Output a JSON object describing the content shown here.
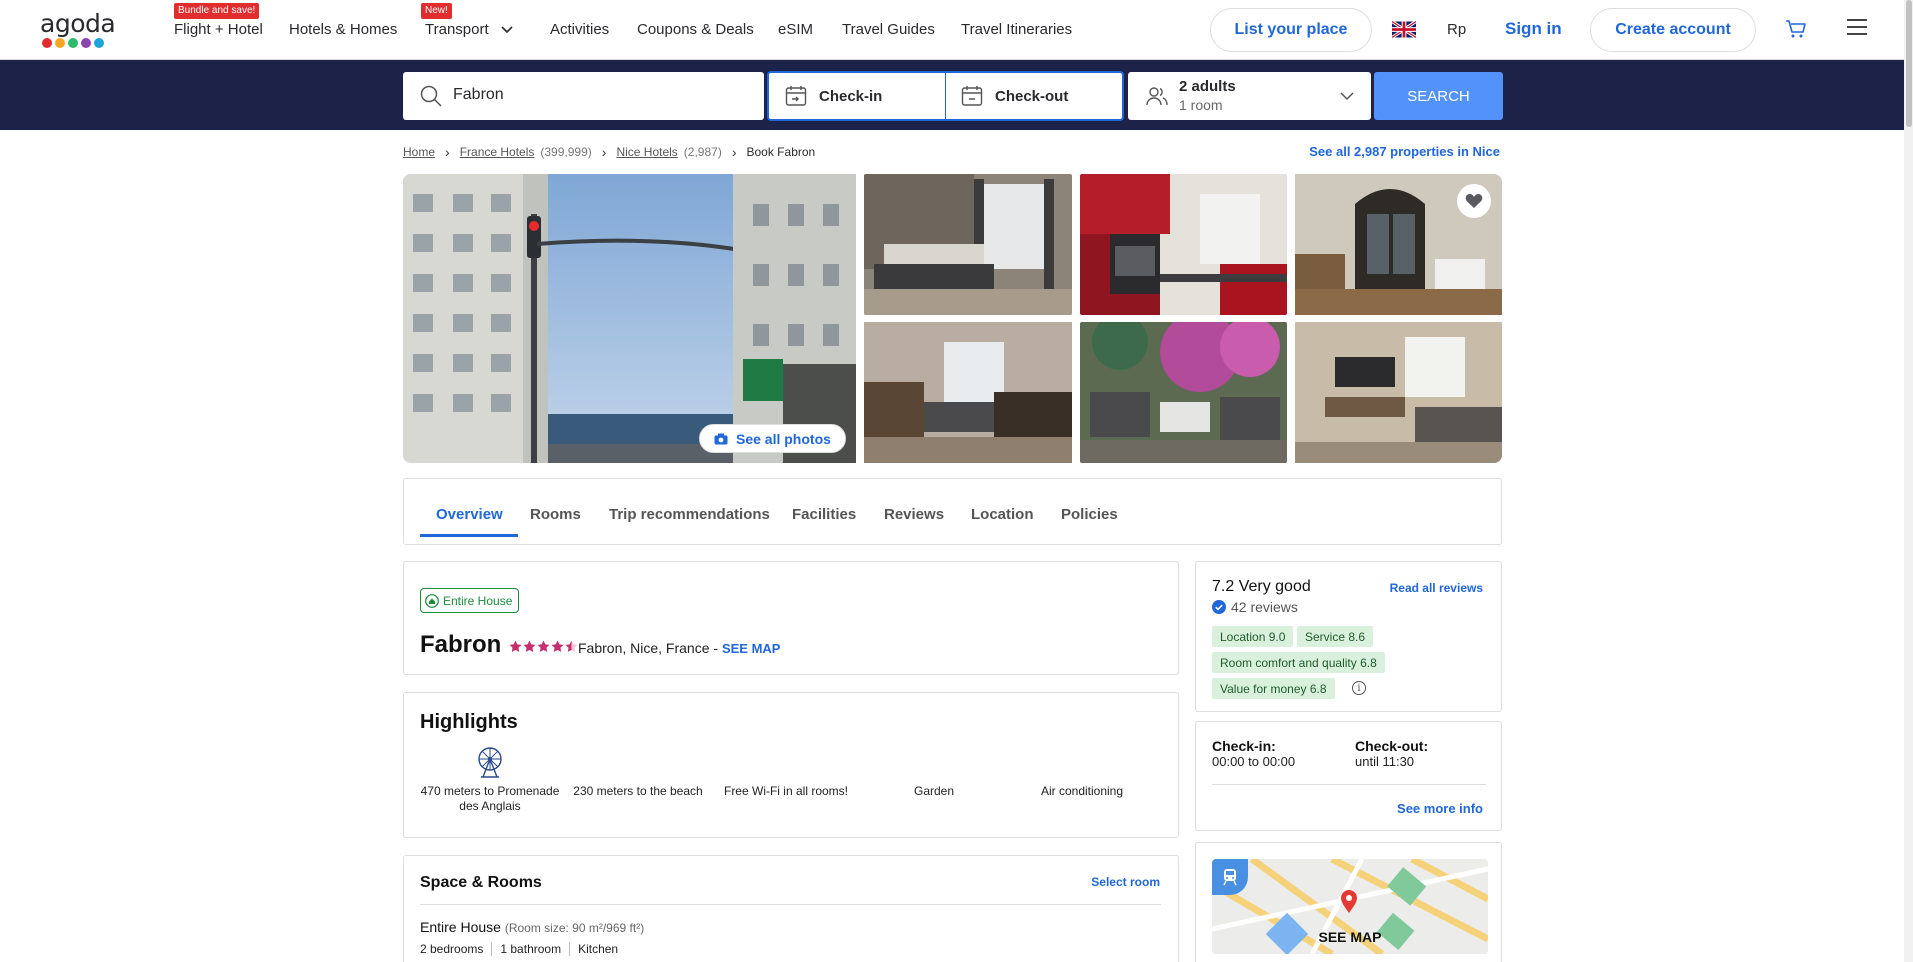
{
  "brand": {
    "name": "agoda",
    "dot_colors": [
      "#e12d2d",
      "#f5a623",
      "#2dbc6b",
      "#8e44ad",
      "#1fa3dd"
    ]
  },
  "topnav": {
    "items": [
      {
        "label": "Flight + Hotel",
        "badge": "Bundle and save!"
      },
      {
        "label": "Hotels & Homes"
      },
      {
        "label": "Transport",
        "badge": "New!"
      },
      {
        "label": "Activities"
      },
      {
        "label": "Coupons & Deals"
      },
      {
        "label": "eSIM"
      },
      {
        "label": "Travel Guides"
      },
      {
        "label": "Travel Itineraries"
      }
    ],
    "list_place": "List your place",
    "currency": "Rp",
    "sign_in": "Sign in",
    "create_account": "Create account"
  },
  "search": {
    "destination": "Fabron",
    "check_in": "Check-in",
    "check_out": "Check-out",
    "guests": "2 adults",
    "rooms": "1 room",
    "button": "SEARCH"
  },
  "breadcrumb": {
    "home": "Home",
    "country": "France Hotels",
    "country_count": "(399,999)",
    "city": "Nice Hotels",
    "city_count": "(2,987)",
    "current": "Book Fabron",
    "see_all": "See all 2,987 properties in Nice"
  },
  "gallery": {
    "see_all_photos": "See all photos"
  },
  "tabs": [
    "Overview",
    "Rooms",
    "Trip recommendations",
    "Facilities",
    "Reviews",
    "Location",
    "Policies"
  ],
  "property": {
    "type": "Entire House",
    "name": "Fabron",
    "star_rating": 4.5,
    "location": "Fabron, Nice, France",
    "see_map": "SEE MAP"
  },
  "highlights": {
    "title": "Highlights",
    "items": [
      {
        "label": "470 meters to Promenade des Anglais",
        "icon": "ferris-wheel-icon"
      },
      {
        "label": "230 meters to the beach"
      },
      {
        "label": "Free Wi-Fi in all rooms!"
      },
      {
        "label": "Garden"
      },
      {
        "label": "Air conditioning"
      }
    ]
  },
  "space_rooms": {
    "title": "Space & Rooms",
    "select_room": "Select room",
    "room_name": "Entire House",
    "room_size": "(Room size: 90 m²/969 ft²)",
    "tags": [
      "2 bedrooms",
      "1 bathroom",
      "Kitchen"
    ]
  },
  "reviews": {
    "score": "7.2 Very good",
    "read_all": "Read all reviews",
    "count": "42 reviews",
    "chips": [
      "Location 9.0",
      "Service 8.6",
      "Room comfort and quality 6.8",
      "Value for money 6.8"
    ],
    "info": "i"
  },
  "checkin_info": {
    "check_in_label": "Check-in:",
    "check_in_value": "00:00 to 00:00",
    "check_out_label": "Check-out:",
    "check_out_value": "until 11:30",
    "see_more": "See more info"
  },
  "map": {
    "label": "SEE MAP"
  },
  "colors": {
    "accent": "#2067da",
    "search_band": "#1c2248",
    "search_button": "#5392f9",
    "score_chip": "#d9f0dc",
    "star": "#c62f6e"
  }
}
